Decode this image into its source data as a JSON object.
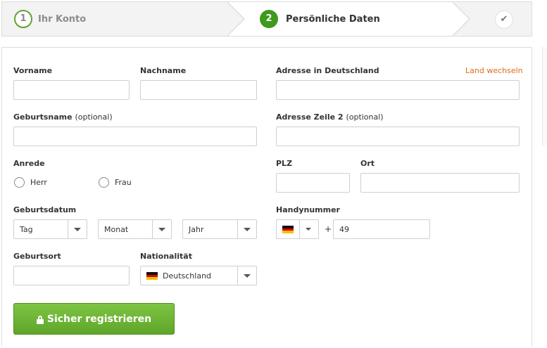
{
  "stepper": {
    "step1": {
      "number": "1",
      "label": "Ihr Konto"
    },
    "step2": {
      "number": "2",
      "label": "Persönliche Daten"
    },
    "step3": {
      "icon": "checkmark-icon"
    }
  },
  "form": {
    "vorname": {
      "label": "Vorname",
      "value": ""
    },
    "nachname": {
      "label": "Nachname",
      "value": ""
    },
    "adresse": {
      "label": "Adresse in Deutschland",
      "value": "",
      "change_country": "Land wechseln"
    },
    "geburtsname": {
      "label": "Geburtsname",
      "optional": "(optional)",
      "value": ""
    },
    "adresse2": {
      "label": "Adresse Zeile 2",
      "optional": "(optional)",
      "value": ""
    },
    "anrede": {
      "label": "Anrede",
      "options": [
        "Herr",
        "Frau"
      ]
    },
    "plz": {
      "label": "PLZ",
      "value": ""
    },
    "ort": {
      "label": "Ort",
      "value": ""
    },
    "geburtsdatum": {
      "label": "Geburtsdatum",
      "tag": "Tag",
      "monat": "Monat",
      "jahr": "Jahr"
    },
    "handynummer": {
      "label": "Handynummer",
      "plus": "+",
      "prefix": "49",
      "flag": "de-flag-icon"
    },
    "geburtsort": {
      "label": "Geburtsort",
      "value": ""
    },
    "nationalitaet": {
      "label": "Nationalität",
      "value": "Deutschland",
      "flag": "de-flag-icon"
    },
    "submit": {
      "label": "Sicher registrieren",
      "icon": "lock-icon"
    }
  },
  "colors": {
    "accent_green": "#5ea52a",
    "link_orange": "#e06b1b"
  }
}
